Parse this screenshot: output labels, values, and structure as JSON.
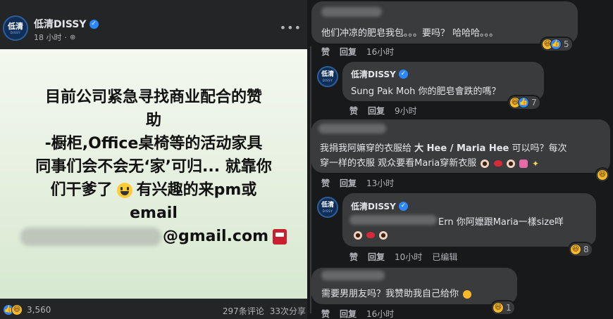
{
  "post": {
    "page_name": "低清DISSY",
    "verified_mark": "✓",
    "logo_text": "低清",
    "logo_sub": "DISSY",
    "time": "18 小时",
    "globe": "⊕",
    "more": "•••",
    "text_lines": [
      "目前公司紧急寻找商业配合的赞",
      "助",
      "-橱柜,Office桌椅等的活动家具",
      "同事们会不会无‘家’可归... 就靠你",
      "们干爹了",
      "有兴趣的来pm或",
      "email",
      "@gmail.com"
    ],
    "reaction_like": "👍",
    "reaction_haha": "😆",
    "reaction_count": "3,560",
    "comments_count": "297条评论",
    "shares_count": "33次分享"
  },
  "comments": {
    "c1": {
      "text": "他们冲凉的肥皂我包。。。要吗？ 哈哈哈。。。",
      "like": "赞",
      "reply": "回复",
      "time": "16小时",
      "reactions": "5"
    },
    "r1": {
      "author": "低清DISSY",
      "text": "Sung Pak Moh 你的肥皂會跌的嗎？",
      "like": "赞",
      "reply": "回复",
      "time": "9小时",
      "reactions": "7"
    },
    "c2": {
      "text_line1_a": "我捐我阿嫲穿的衣服给 ",
      "mention": "大 Hee / Maria Hee",
      "text_line1_b": " 可以吗？每次",
      "text_line2": "穿一样的衣服 观众要看Maria穿新衣服",
      "like": "赞",
      "reply": "回复",
      "time": "13小时"
    },
    "r2": {
      "author": "低清DISSY",
      "text_suffix": "Ern 你阿嬤跟Maria一樣size咩",
      "like": "赞",
      "reply": "回复",
      "time": "10小时",
      "edited": "已编辑",
      "reactions": "8"
    },
    "c3": {
      "text": "需要男朋友吗？我赞助我自己给你",
      "like": "赞",
      "reply": "回复",
      "time": "16小时",
      "reactions": "1"
    }
  },
  "colors": {
    "accent": "#2d88ff",
    "bubble": "#3a3b3c",
    "haha": "#f7b928"
  }
}
